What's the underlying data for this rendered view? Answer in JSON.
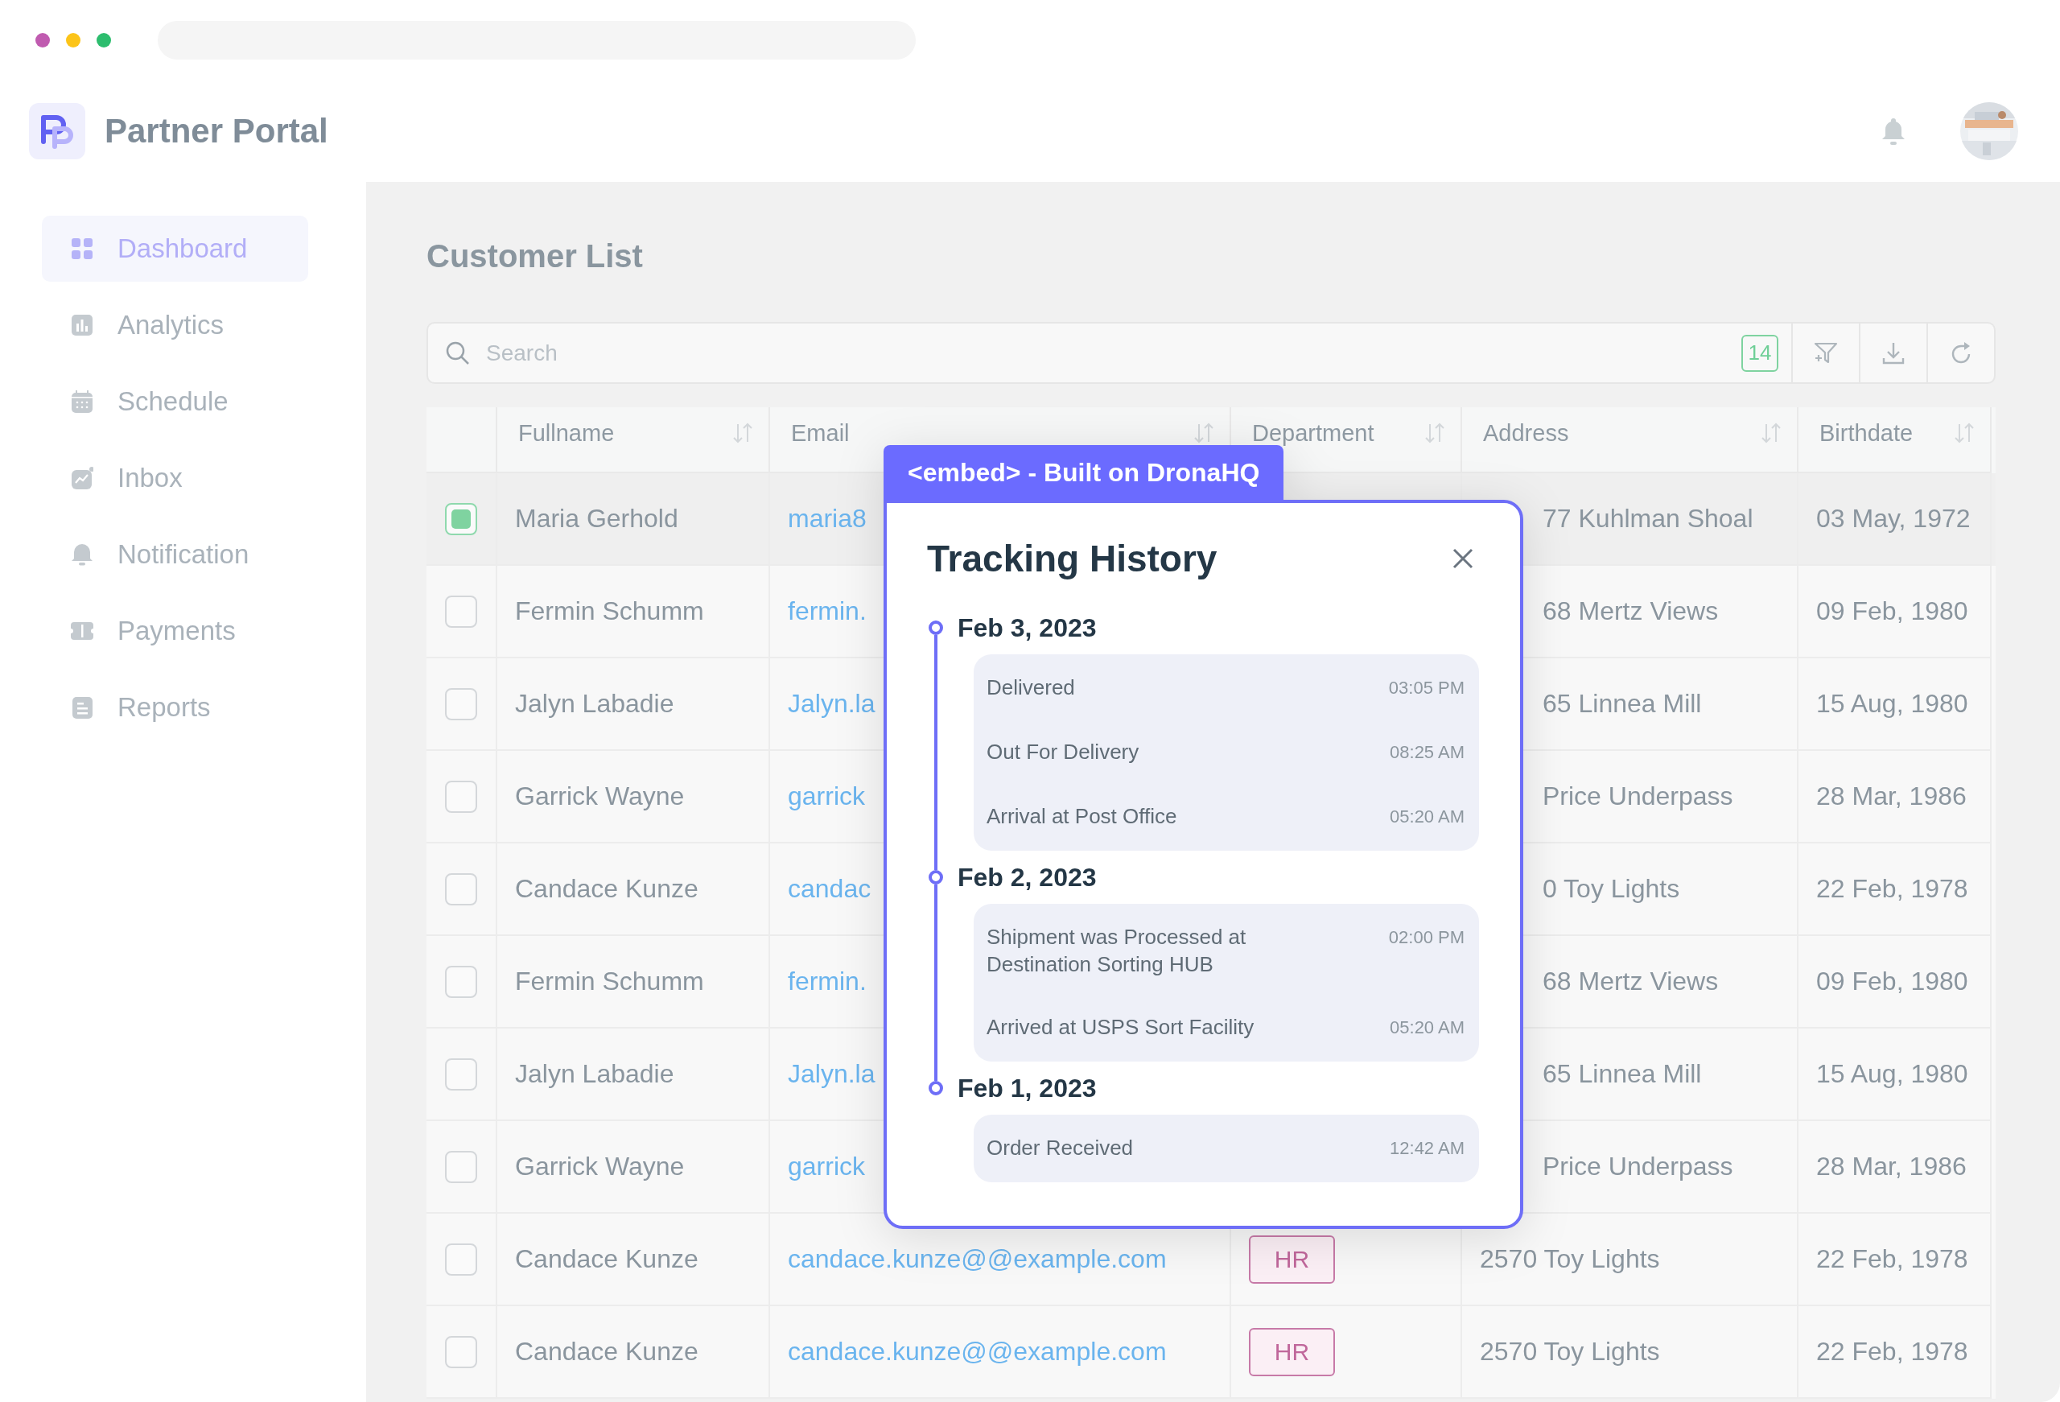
{
  "browser": {
    "dots": [
      {
        "color": "#c05bb0"
      },
      {
        "color": "#fcc419"
      },
      {
        "color": "#2dbd6e"
      }
    ]
  },
  "app": {
    "title": "Partner Portal"
  },
  "sidebar": {
    "items": [
      {
        "label": "Dashboard",
        "selected": true
      },
      {
        "label": "Analytics",
        "selected": false
      },
      {
        "label": "Schedule",
        "selected": false
      },
      {
        "label": "Inbox",
        "selected": false
      },
      {
        "label": "Notification",
        "selected": false
      },
      {
        "label": "Payments",
        "selected": false
      },
      {
        "label": "Reports",
        "selected": false
      }
    ]
  },
  "page": {
    "title": "Customer List"
  },
  "toolbar": {
    "search": {
      "placeholder": "Search"
    },
    "count": "14"
  },
  "table": {
    "columns": [
      "Fullname",
      "Email",
      "Department",
      "Address",
      "Birthdate"
    ],
    "rows": [
      {
        "selected": true,
        "name": "Maria Gerhold",
        "email": "maria8",
        "address": "77 Kuhlman Shoal",
        "birthdate": "03 May, 1972",
        "under_modal": true
      },
      {
        "selected": false,
        "name": "Fermin Schumm",
        "email": "fermin.",
        "address": "68 Mertz Views",
        "birthdate": "09 Feb, 1980",
        "under_modal": true
      },
      {
        "selected": false,
        "name": "Jalyn Labadie",
        "email": "Jalyn.la",
        "address": "65 Linnea Mill",
        "birthdate": "15 Aug, 1980",
        "under_modal": true
      },
      {
        "selected": false,
        "name": "Garrick Wayne",
        "email": "garrick",
        "address": "Price Underpass",
        "birthdate": "28 Mar, 1986",
        "under_modal": true
      },
      {
        "selected": false,
        "name": "Candace Kunze",
        "email": "candac",
        "address": "0 Toy Lights",
        "birthdate": "22 Feb, 1978",
        "under_modal": true
      },
      {
        "selected": false,
        "name": "Fermin Schumm",
        "email": "fermin.",
        "address": "68 Mertz Views",
        "birthdate": "09 Feb, 1980",
        "under_modal": true
      },
      {
        "selected": false,
        "name": "Jalyn Labadie",
        "email": "Jalyn.la",
        "address": "65 Linnea Mill",
        "birthdate": "15 Aug, 1980",
        "under_modal": true
      },
      {
        "selected": false,
        "name": "Garrick Wayne",
        "email": "garrick",
        "address": "Price Underpass",
        "birthdate": "28 Mar, 1986",
        "under_modal": true
      },
      {
        "selected": false,
        "name": "Candace Kunze",
        "email": "candace.kunze@@example.com",
        "department": "HR",
        "address": "2570 Toy Lights",
        "birthdate": "22 Feb, 1978",
        "under_modal": false
      },
      {
        "selected": false,
        "name": "Candace Kunze",
        "email": "candace.kunze@@example.com",
        "department": "HR",
        "address": "2570 Toy Lights",
        "birthdate": "22 Feb, 1978",
        "under_modal": false
      }
    ]
  },
  "modal": {
    "tab": "<embed> - Built on DronaHQ",
    "title": "Tracking History",
    "groups": [
      {
        "date": "Feb 3, 2023",
        "events": [
          {
            "label": "Delivered",
            "time": "03:05 PM"
          },
          {
            "label": "Out For Delivery",
            "time": "08:25 AM"
          },
          {
            "label": "Arrival at Post Office",
            "time": "05:20 AM"
          }
        ]
      },
      {
        "date": "Feb 2, 2023",
        "events": [
          {
            "label": "Shipment was Processed at Destination Sorting HUB",
            "time": "02:00 PM"
          },
          {
            "label": "Arrived at USPS Sort Facility",
            "time": "05:20 AM"
          }
        ]
      },
      {
        "date": "Feb 1, 2023",
        "events": [
          {
            "label": "Order Received",
            "time": "12:42 AM"
          }
        ]
      }
    ]
  }
}
